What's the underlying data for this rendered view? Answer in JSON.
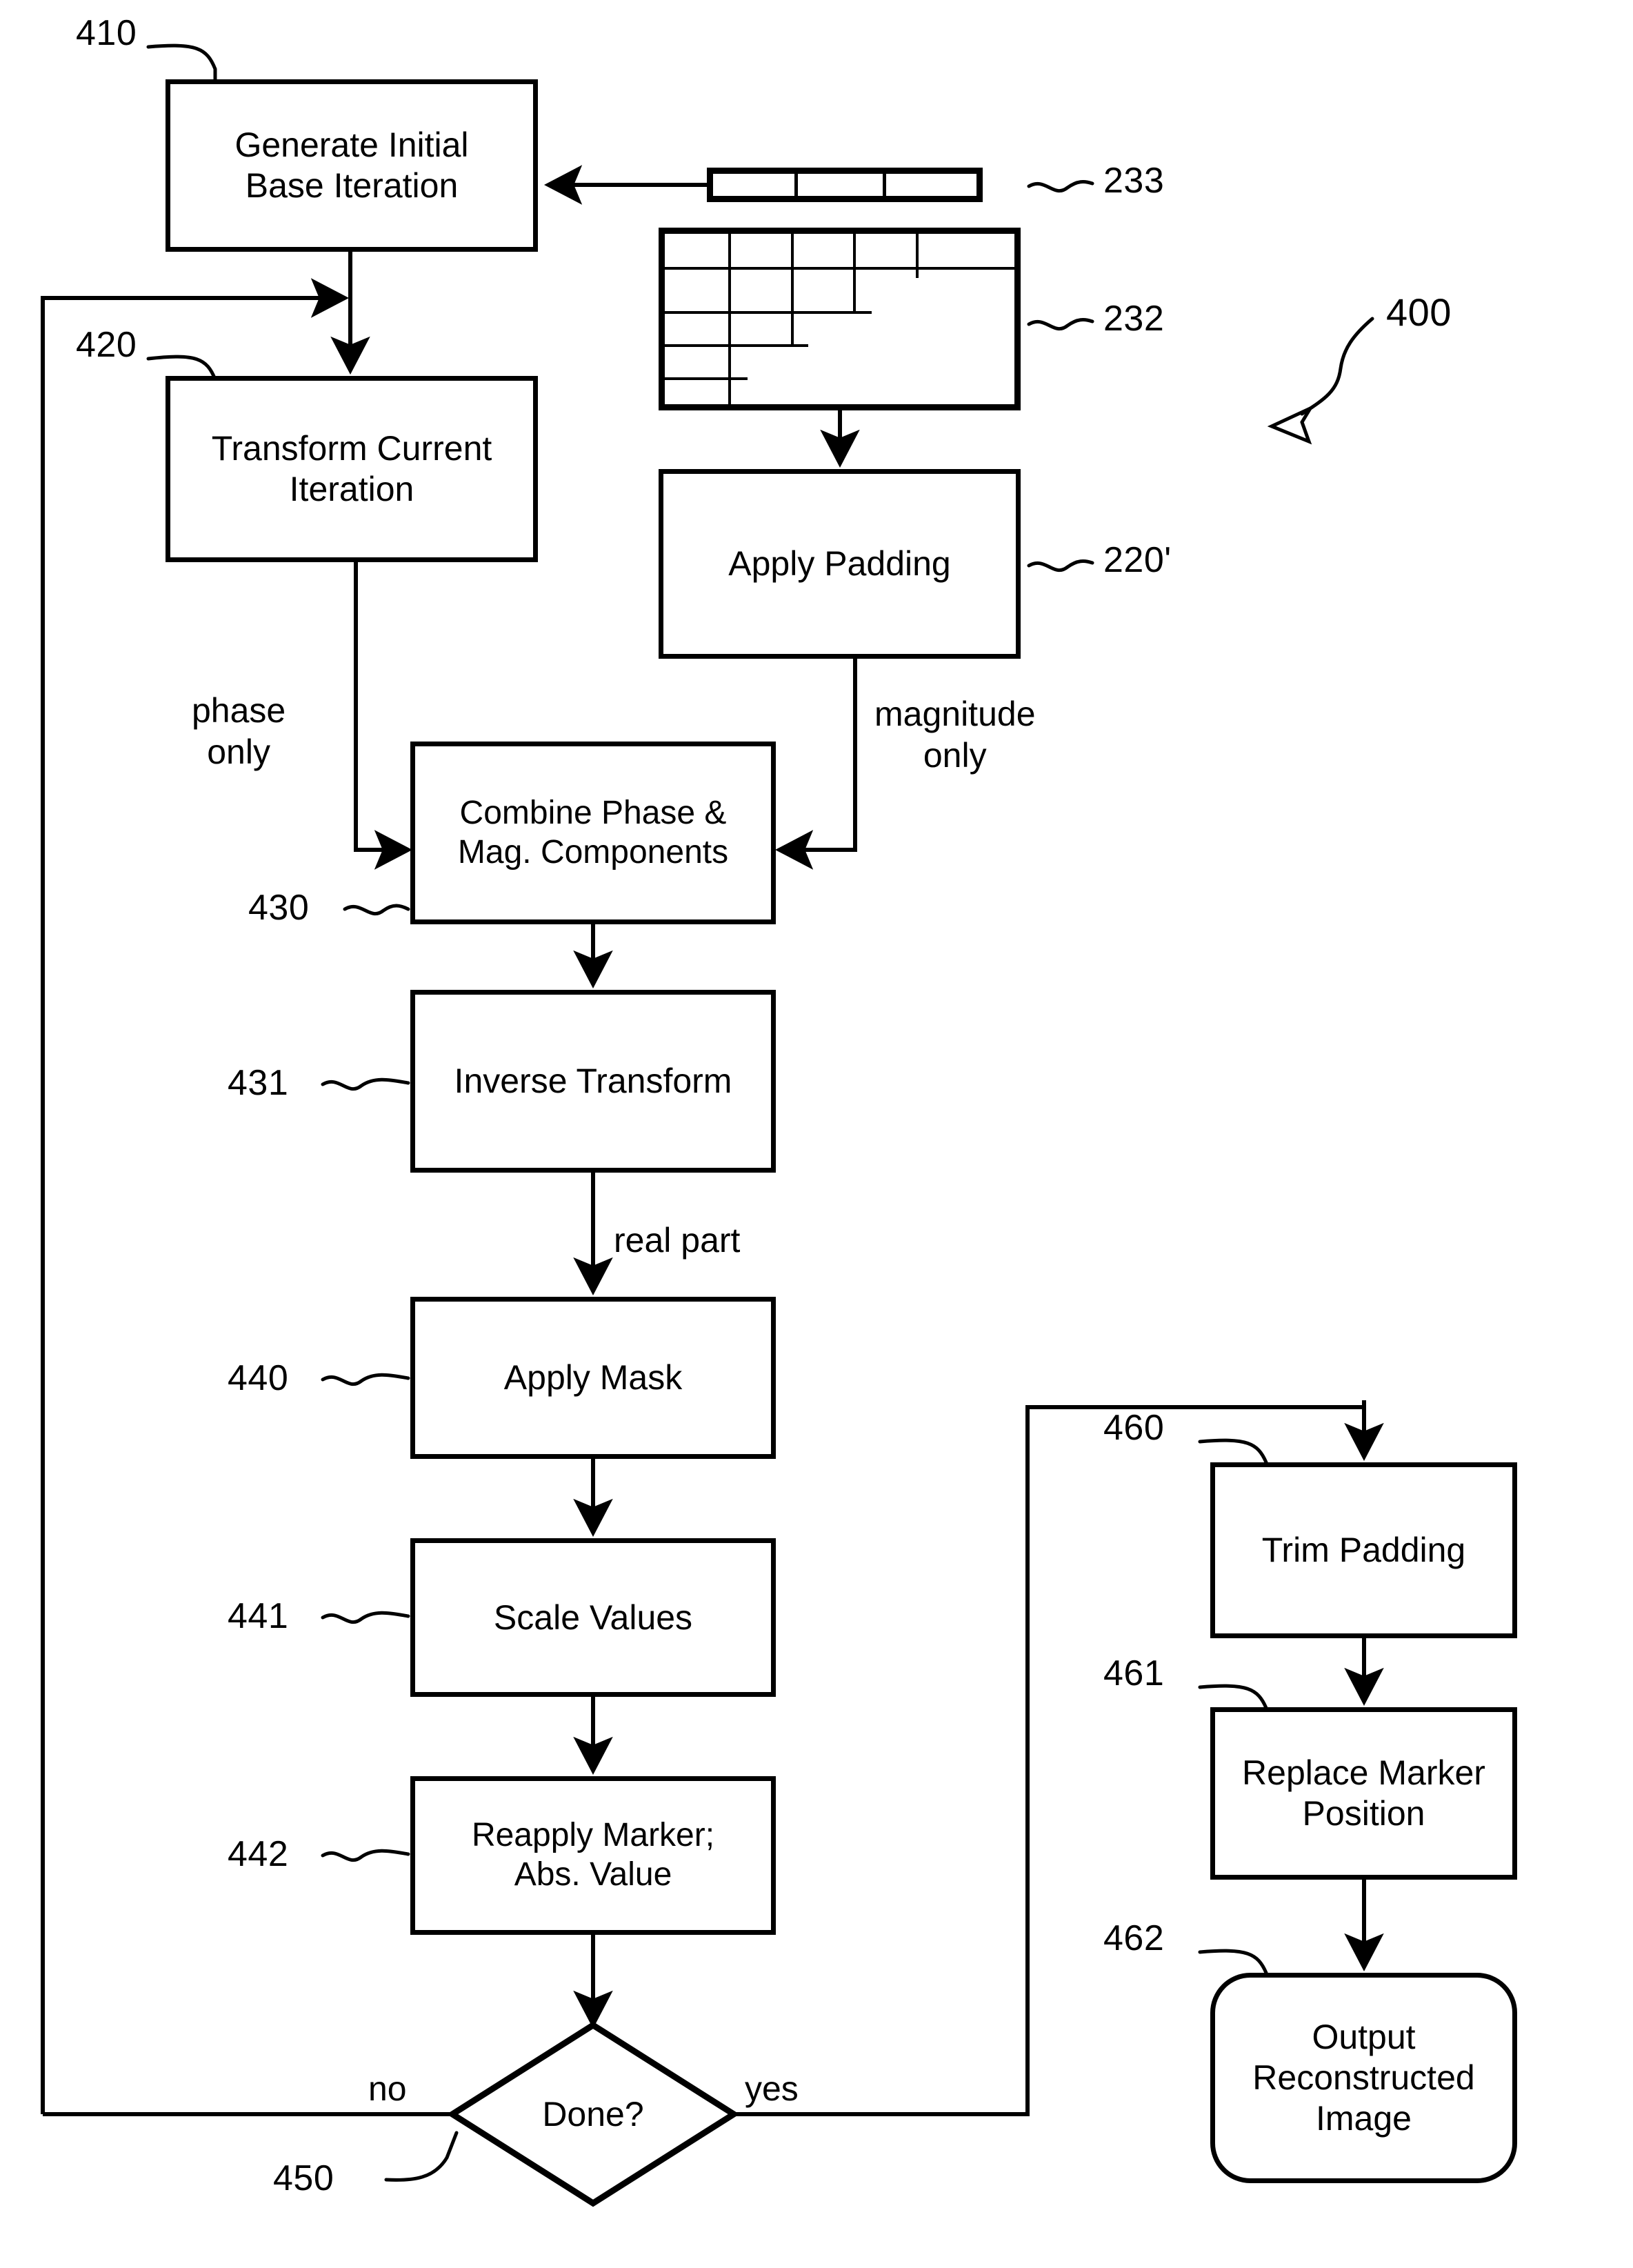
{
  "figure": {
    "number": "400",
    "type": "patent-flowchart"
  },
  "nodes": {
    "generate_initial": {
      "ref": "410",
      "label": "Generate Initial\nBase Iteration"
    },
    "transform_current": {
      "ref": "420",
      "label": "Transform  Current\nIteration"
    },
    "apply_padding": {
      "ref": "220'",
      "label": "Apply Padding"
    },
    "combine": {
      "ref": "430",
      "label": "Combine Phase &\nMag. Components"
    },
    "inverse_transform": {
      "ref": "431",
      "label": "Inverse Transform"
    },
    "apply_mask": {
      "ref": "440",
      "label": "Apply Mask"
    },
    "scale_values": {
      "ref": "441",
      "label": "Scale Values"
    },
    "reapply_marker": {
      "ref": "442",
      "label": "Reapply Marker;\nAbs. Value"
    },
    "done_decision": {
      "ref": "450",
      "label": "Done?"
    },
    "trim_padding": {
      "ref": "460",
      "label": "Trim Padding"
    },
    "replace_marker": {
      "ref": "461",
      "label": "Replace Marker\nPosition"
    },
    "output_image": {
      "ref": "462",
      "label": "Output\nReconstructed\nImage"
    },
    "data_bar": {
      "ref": "233"
    },
    "data_grid": {
      "ref": "232"
    }
  },
  "edge_labels": {
    "phase_only": "phase\nonly",
    "magnitude_only": "magnitude\nonly",
    "real_part": "real part",
    "no": "no",
    "yes": "yes"
  },
  "refs": {
    "r410": "410",
    "r420": "420",
    "r430": "430",
    "r431": "431",
    "r440": "440",
    "r441": "441",
    "r442": "442",
    "r450": "450",
    "r460": "460",
    "r461": "461",
    "r462": "462",
    "r232": "232",
    "r233": "233",
    "r220p": "220'",
    "r400": "400"
  },
  "colors": {
    "ink": "#000000",
    "paper": "#ffffff"
  }
}
